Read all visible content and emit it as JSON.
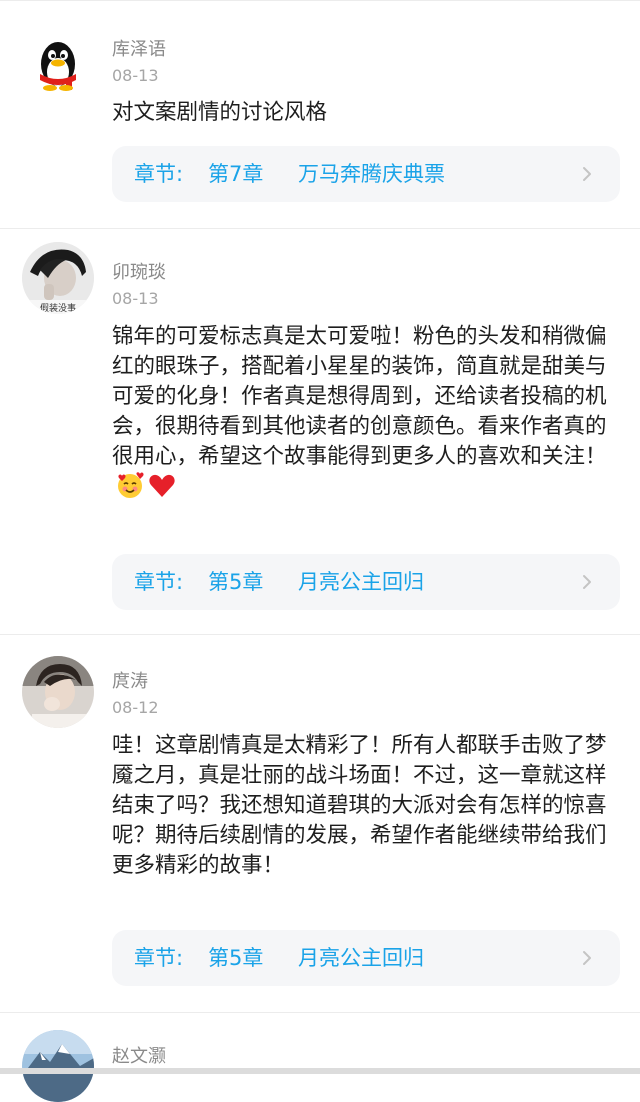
{
  "comments": [
    {
      "username": "库泽语",
      "date": "08-13",
      "avatar": "qq-penguin-icon",
      "text": "对文案剧情的讨论风格",
      "chapter": {
        "label": "章节:",
        "number": "第7章",
        "title": "万马奔腾庆典票"
      }
    },
    {
      "username": "卯琬琰",
      "date": "08-13",
      "avatar": "user-photo",
      "avatar_caption": "假装没事",
      "text": "锦年的可爱标志真是太可爱啦！粉色的头发和稍微偏红的眼珠子，搭配着小星星的装饰，简直就是甜美与可爱的化身！作者真是想得周到，还给读者投稿的机会，很期待看到其他读者的创意颜色。看来作者真的很用心，希望这个故事能得到更多人的喜欢和关注！",
      "emojis": [
        "smiling-face-with-hearts",
        "red-heart"
      ],
      "chapter": {
        "label": "章节:",
        "number": "第5章",
        "title": "月亮公主回归"
      }
    },
    {
      "username": "庹涛",
      "date": "08-12",
      "avatar": "user-photo",
      "text": "哇！这章剧情真是太精彩了！所有人都联手击败了梦魇之月，真是壮丽的战斗场面！不过，这一章就这样结束了吗？我还想知道碧琪的大派对会有怎样的惊喜呢？期待后续剧情的发展，希望作者能继续带给我们更多精彩的故事！",
      "chapter": {
        "label": "章节:",
        "number": "第5章",
        "title": "月亮公主回归"
      }
    },
    {
      "username": "赵文灏",
      "avatar": "mountain-photo"
    }
  ],
  "colors": {
    "accent": "#1aa3e8",
    "chapter_bg": "#f5f6f8",
    "username": "#8a8a8a",
    "date": "#a6a6a6",
    "text": "#1e1e1e"
  }
}
